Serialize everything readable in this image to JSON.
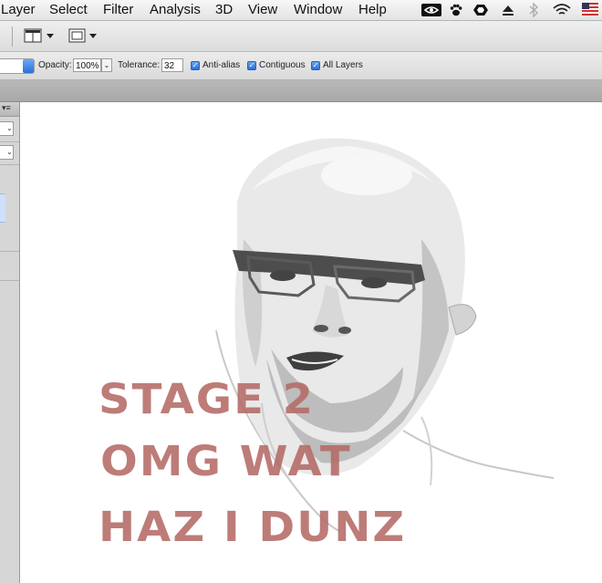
{
  "menubar": {
    "items": [
      "Layer",
      "Select",
      "Filter",
      "Analysis",
      "3D",
      "View",
      "Window",
      "Help"
    ],
    "status_icons": [
      "nvidia-icon",
      "paw-icon",
      "hexagon-icon",
      "eject-icon",
      "bluetooth-icon",
      "wifi-icon",
      "flag-us-icon"
    ]
  },
  "appbar": {
    "arrange_icon": "arrange-documents-icon",
    "screen_mode_icon": "screen-mode-icon"
  },
  "options": {
    "opacity_label": "Opacity:",
    "opacity_value": "100%",
    "tolerance_label": "Tolerance:",
    "tolerance_value": "32",
    "anti_alias_label": "Anti-alias",
    "contiguous_label": "Contiguous",
    "all_layers_label": "All Layers",
    "anti_alias_checked": true,
    "contiguous_checked": true,
    "all_layers_checked": true
  },
  "canvas": {
    "line1": "STAGE 2",
    "line2": "OMG WAT",
    "line3": "HAZ I DUNZ",
    "text_color": "#b46a66"
  },
  "colors": {
    "checkbox_accent": "#2a6fd6",
    "selected_row": "#cfe0fb"
  }
}
